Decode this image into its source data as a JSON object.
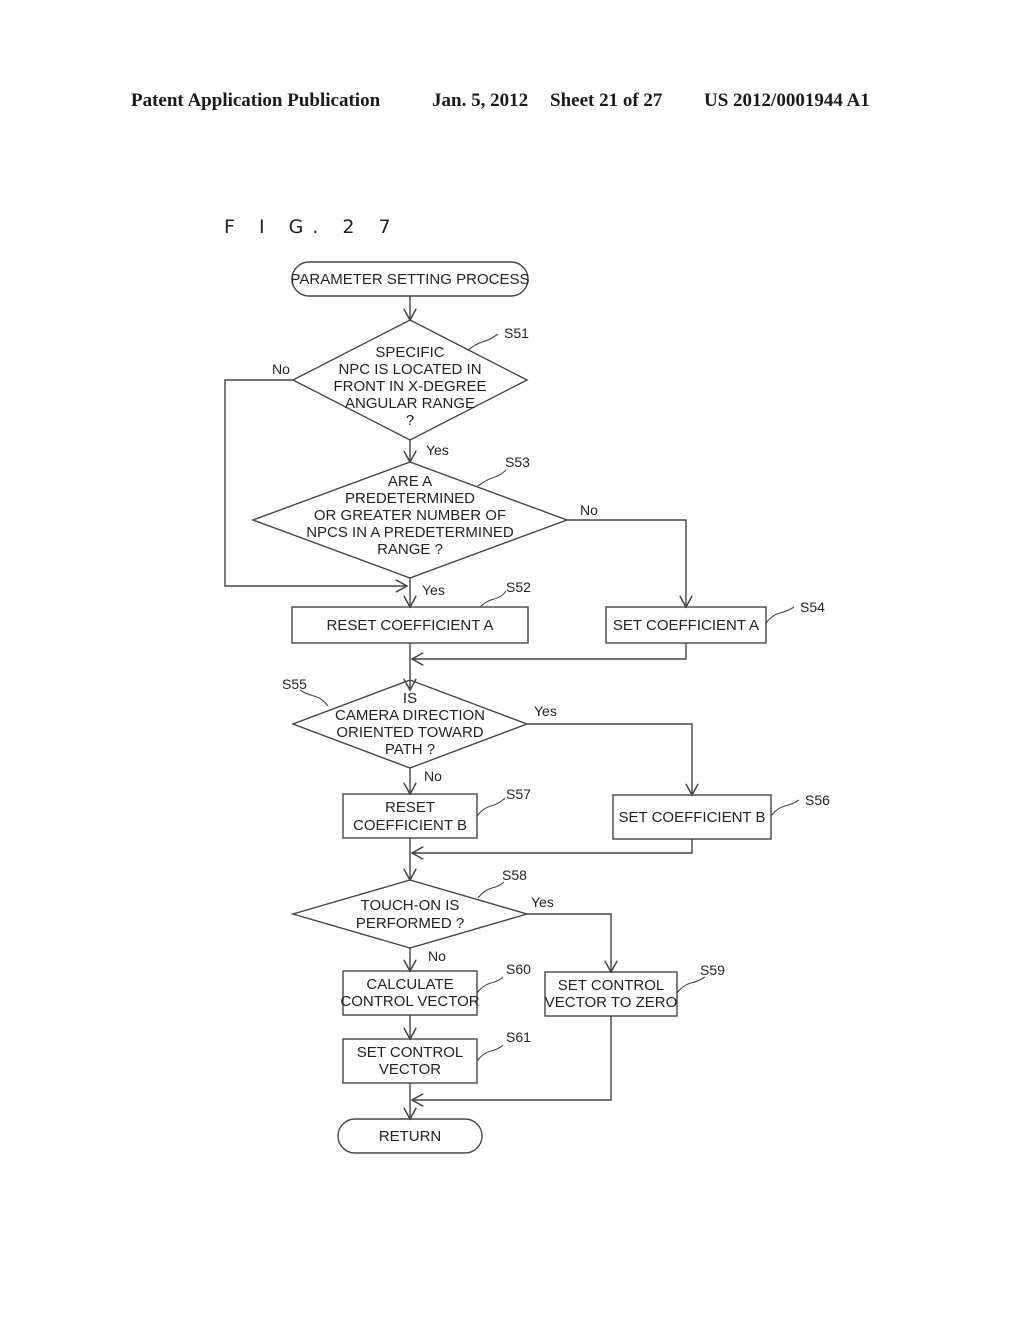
{
  "header": {
    "publication": "Patent Application Publication",
    "date": "Jan. 5, 2012",
    "sheet": "Sheet 21 of 27",
    "number": "US 2012/0001944 A1"
  },
  "figure_label": "F I G. 2 7",
  "flowchart": {
    "start": "PARAMETER SETTING PROCESS",
    "end": "RETURN",
    "steps": {
      "S51": {
        "id": "S51",
        "type": "decision",
        "lines": [
          "SPECIFIC",
          "NPC IS LOCATED IN",
          "FRONT IN X-DEGREE",
          "ANGULAR RANGE",
          "?"
        ]
      },
      "S53": {
        "id": "S53",
        "type": "decision",
        "lines": [
          "ARE A",
          "PREDETERMINED",
          "OR GREATER NUMBER OF",
          "NPCS IN A PREDETERMINED",
          "RANGE ?"
        ]
      },
      "S52": {
        "id": "S52",
        "type": "process",
        "lines": [
          "RESET COEFFICIENT A"
        ]
      },
      "S54": {
        "id": "S54",
        "type": "process",
        "lines": [
          "SET COEFFICIENT A"
        ]
      },
      "S55": {
        "id": "S55",
        "type": "decision",
        "lines": [
          "IS",
          "CAMERA DIRECTION",
          "ORIENTED TOWARD",
          "PATH ?"
        ]
      },
      "S57": {
        "id": "S57",
        "type": "process",
        "lines": [
          "RESET",
          "COEFFICIENT B"
        ]
      },
      "S56": {
        "id": "S56",
        "type": "process",
        "lines": [
          "SET COEFFICIENT B"
        ]
      },
      "S58": {
        "id": "S58",
        "type": "decision",
        "lines": [
          "TOUCH-ON IS",
          "PERFORMED ?"
        ]
      },
      "S60": {
        "id": "S60",
        "type": "process",
        "lines": [
          "CALCULATE",
          "CONTROL VECTOR"
        ]
      },
      "S59": {
        "id": "S59",
        "type": "process",
        "lines": [
          "SET CONTROL",
          "VECTOR TO ZERO"
        ]
      },
      "S61": {
        "id": "S61",
        "type": "process",
        "lines": [
          "SET CONTROL",
          "VECTOR"
        ]
      }
    },
    "branch_labels": {
      "S51_no": "No",
      "S51_yes": "Yes",
      "S53_no": "No",
      "S53_yes": "Yes",
      "S55_yes": "Yes",
      "S55_no": "No",
      "S58_yes": "Yes",
      "S58_no": "No"
    }
  }
}
